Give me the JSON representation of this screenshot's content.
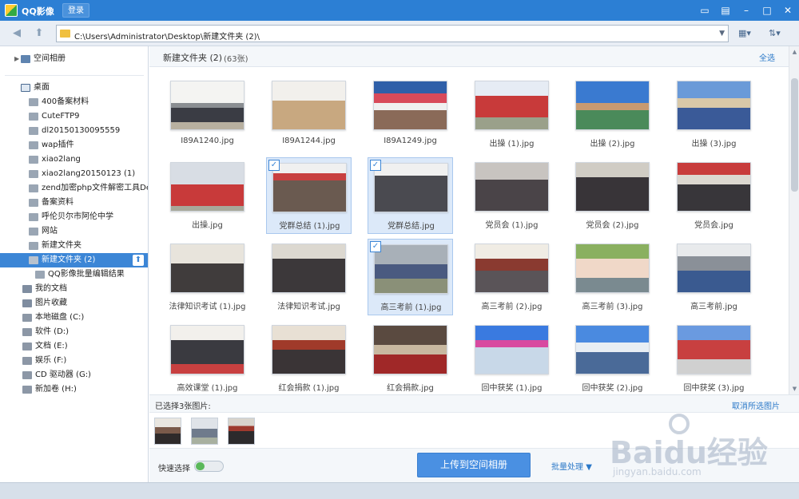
{
  "titlebar": {
    "title": "QQ影像",
    "login_label": "登录"
  },
  "address": {
    "path": "C:\\Users\\Administrator\\Desktop\\新建文件夹 (2)\\"
  },
  "sidebar": {
    "items": [
      {
        "label": "空间相册"
      },
      {
        "label": "桌面"
      },
      {
        "label": "400备案材料"
      },
      {
        "label": "CuteFTP9"
      },
      {
        "label": "dl20150130095559"
      },
      {
        "label": "wap插件"
      },
      {
        "label": "xiao2lang"
      },
      {
        "label": "xiao2lang20150123 (1)"
      },
      {
        "label": "zend加密php文件解密工具Dez"
      },
      {
        "label": "备案资料"
      },
      {
        "label": "呼伦贝尔市阿伦中学"
      },
      {
        "label": "网站"
      },
      {
        "label": "新建文件夹"
      },
      {
        "label": "新建文件夹 (2)"
      },
      {
        "label": "QQ影像批量编辑结果"
      },
      {
        "label": "我的文档"
      },
      {
        "label": "图片收藏"
      },
      {
        "label": "本地磁盘 (C:)"
      },
      {
        "label": "软件 (D:)"
      },
      {
        "label": "文档 (E:)"
      },
      {
        "label": "娱乐 (F:)"
      },
      {
        "label": "CD 驱动器 (G:)"
      },
      {
        "label": "新加卷 (H:)"
      }
    ]
  },
  "main": {
    "folder_title": "新建文件夹 (2)",
    "count": "(63张)",
    "select_all": "全选",
    "photos": [
      {
        "name": "I89A1240.jpg",
        "selected": false
      },
      {
        "name": "I89A1244.jpg",
        "selected": false
      },
      {
        "name": "I89A1249.jpg",
        "selected": false
      },
      {
        "name": "出操 (1).jpg",
        "selected": false
      },
      {
        "name": "出操 (2).jpg",
        "selected": false
      },
      {
        "name": "出操 (3).jpg",
        "selected": false
      },
      {
        "name": "出操.jpg",
        "selected": false
      },
      {
        "name": "党群总结 (1).jpg",
        "selected": true
      },
      {
        "name": "党群总结.jpg",
        "selected": true
      },
      {
        "name": "党员会 (1).jpg",
        "selected": false
      },
      {
        "name": "党员会 (2).jpg",
        "selected": false
      },
      {
        "name": "党员会.jpg",
        "selected": false
      },
      {
        "name": "法律知识考试 (1).jpg",
        "selected": false
      },
      {
        "name": "法律知识考试.jpg",
        "selected": false
      },
      {
        "name": "高三考前 (1).jpg",
        "selected": true
      },
      {
        "name": "高三考前 (2).jpg",
        "selected": false
      },
      {
        "name": "高三考前 (3).jpg",
        "selected": false
      },
      {
        "name": "高三考前.jpg",
        "selected": false
      },
      {
        "name": "高效课堂 (1).jpg",
        "selected": false
      },
      {
        "name": "红会捐款 (1).jpg",
        "selected": false
      },
      {
        "name": "红会捐款.jpg",
        "selected": false
      },
      {
        "name": "回中获奖 (1).jpg",
        "selected": false
      },
      {
        "name": "回中获奖 (2).jpg",
        "selected": false
      },
      {
        "name": "回中获奖 (3).jpg",
        "selected": false
      }
    ]
  },
  "tray": {
    "label": "已选择3张图片:",
    "clear_label": "取消所选图片"
  },
  "actions": {
    "quick_select_label": "快速选择",
    "upload_label": "上传到空间相册",
    "batch_label": "批量处理"
  },
  "watermark": {
    "text": "Baidu经验",
    "url": "jingyan.baidu.com"
  },
  "colors": {
    "titlebar": "#2c7fd4",
    "selected_row": "#3c86d6",
    "selected_cell": "#dce9f9",
    "link": "#2a78c8",
    "button": "#4a90e2"
  }
}
